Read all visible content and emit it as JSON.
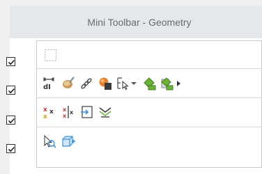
{
  "window": {
    "title": "Mini Toolbar - Geometry"
  },
  "rows": [
    {
      "id": "row1",
      "checked": true,
      "icons": [
        "empty-slot-icon"
      ]
    },
    {
      "id": "row2",
      "checked": true,
      "icons": [
        "dimension-icon",
        "brush-icon",
        "chain-link-icon",
        "cube-sphere-icon",
        "selection-filter-icon",
        "dropdown-arrow-icon",
        "paint-bucket-icon",
        "paint-bucket-alt-icon",
        "more-arrow-icon"
      ]
    },
    {
      "id": "row3",
      "checked": true,
      "icons": [
        "scale-x-icon",
        "mirror-x-icon",
        "insert-box-icon",
        "spring-icon"
      ]
    },
    {
      "id": "row4",
      "checked": true,
      "icons": [
        "zoom-select-icon",
        "add-box-icon"
      ]
    }
  ],
  "colors": {
    "title_bar": "#e5e8eb",
    "title_text": "#646b73",
    "accent_blue": "#3c8fd6",
    "accent_green": "#6bb23a",
    "accent_orange": "#e8812a"
  }
}
